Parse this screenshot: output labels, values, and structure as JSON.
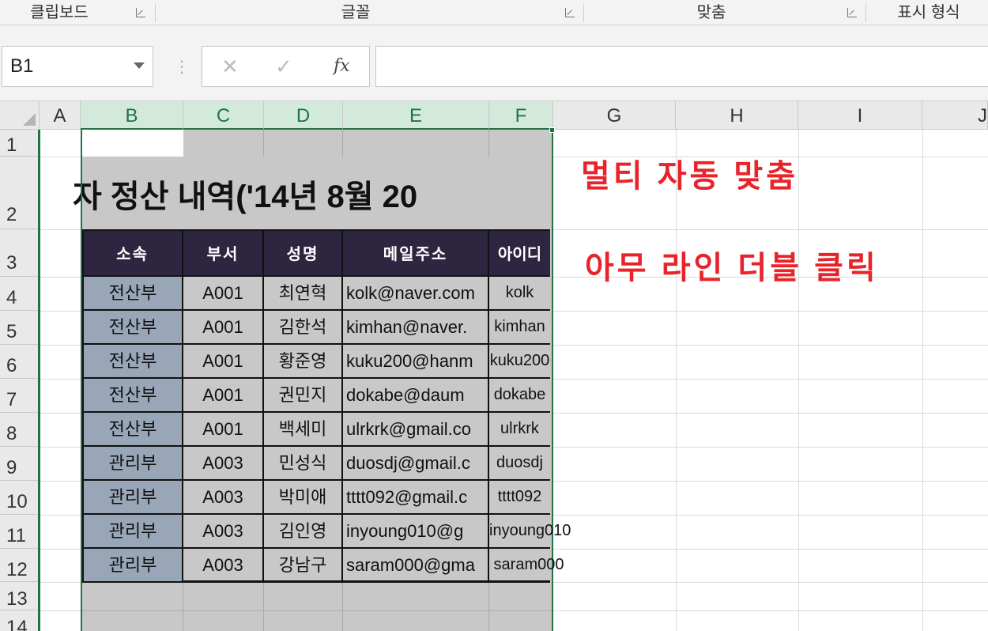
{
  "ribbon": {
    "groups": [
      "클립보드",
      "글꼴",
      "맞춤",
      "표시 형식"
    ]
  },
  "formula_bar": {
    "name_box": "B1",
    "cancel": "✕",
    "enter": "✓",
    "fx": "fx",
    "formula": ""
  },
  "columns": [
    "A",
    "B",
    "C",
    "D",
    "E",
    "F",
    "G",
    "H",
    "I",
    "J"
  ],
  "rows": [
    "1",
    "2",
    "3",
    "4",
    "5",
    "6",
    "7",
    "8",
    "9",
    "10",
    "11",
    "12",
    "13",
    "14"
  ],
  "sheet": {
    "title": "자 정산 내역('14년 8월 20",
    "headers": [
      "소속",
      "부서",
      "성명",
      "메일주소",
      "아이디"
    ],
    "records": [
      {
        "dept": "전산부",
        "code": "A001",
        "name": "최연혁",
        "email": "kolk@naver.com",
        "id": "kolk"
      },
      {
        "dept": "전산부",
        "code": "A001",
        "name": "김한석",
        "email": "kimhan@naver.",
        "id": "kimhan"
      },
      {
        "dept": "전산부",
        "code": "A001",
        "name": "황준영",
        "email": "kuku200@hanm",
        "id": "kuku200"
      },
      {
        "dept": "전산부",
        "code": "A001",
        "name": "권민지",
        "email": "dokabe@daum",
        "id": "dokabe"
      },
      {
        "dept": "전산부",
        "code": "A001",
        "name": "백세미",
        "email": "ulrkrk@gmail.co",
        "id": "ulrkrk"
      },
      {
        "dept": "관리부",
        "code": "A003",
        "name": "민성식",
        "email": "duosdj@gmail.c",
        "id": "duosdj"
      },
      {
        "dept": "관리부",
        "code": "A003",
        "name": "박미애",
        "email": "tttt092@gmail.c",
        "id": "tttt092"
      },
      {
        "dept": "관리부",
        "code": "A003",
        "name": "김인영",
        "email": "inyoung010@g",
        "id": "inyoung010"
      },
      {
        "dept": "관리부",
        "code": "A003",
        "name": "강남구",
        "email": "saram000@gma",
        "id": "saram000"
      }
    ]
  },
  "annotations": {
    "line1": "멀티 자동 맞춤",
    "line2": "아무 라인 더블 클릭"
  },
  "colors": {
    "selection": "#217346",
    "header_bg": "#2e2640",
    "dept_bg": "#98a6b8",
    "annotation": "#e8232a"
  }
}
